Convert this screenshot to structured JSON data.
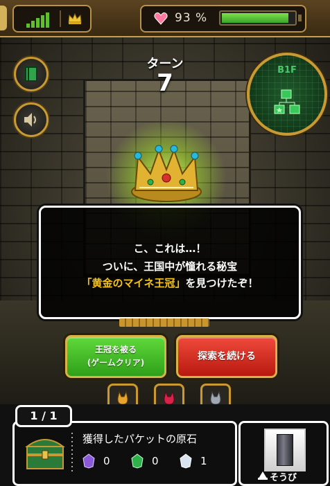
{
  "status": {
    "battery_percent": 93,
    "battery_label": "93 %",
    "signal_icon": "signal-bars-icon",
    "crown_icon": "crown-icon",
    "heart_icon": "heart-icon"
  },
  "turn": {
    "label": "ターン",
    "value": "7"
  },
  "minimap": {
    "floor": "B1F"
  },
  "dialog": {
    "line1": "こ、これは…！",
    "line2": "ついに、王国中が憧れる秘宝",
    "line3_highlight": "「黄金のマイネ王冠」",
    "line3_rest": "を見つけたぞ！"
  },
  "actions": {
    "crown_line1": "王冠を被る",
    "crown_line2": "(ゲームクリア)",
    "continue": "探索を続ける"
  },
  "bottom": {
    "counter": "1 / 1",
    "packet_title": "獲得したパケットの原石",
    "gems": [
      {
        "color": "purple",
        "count": "0"
      },
      {
        "color": "green",
        "count": "0"
      },
      {
        "color": "white",
        "count": "1"
      }
    ],
    "equip_label": "そうび"
  },
  "colors": {
    "accent_gold": "#c99a33",
    "highlight_text": "#f3c21b",
    "crown_button": "#2f9f1a",
    "continue_button": "#b7190f",
    "battery_fill": "#38a52a"
  }
}
